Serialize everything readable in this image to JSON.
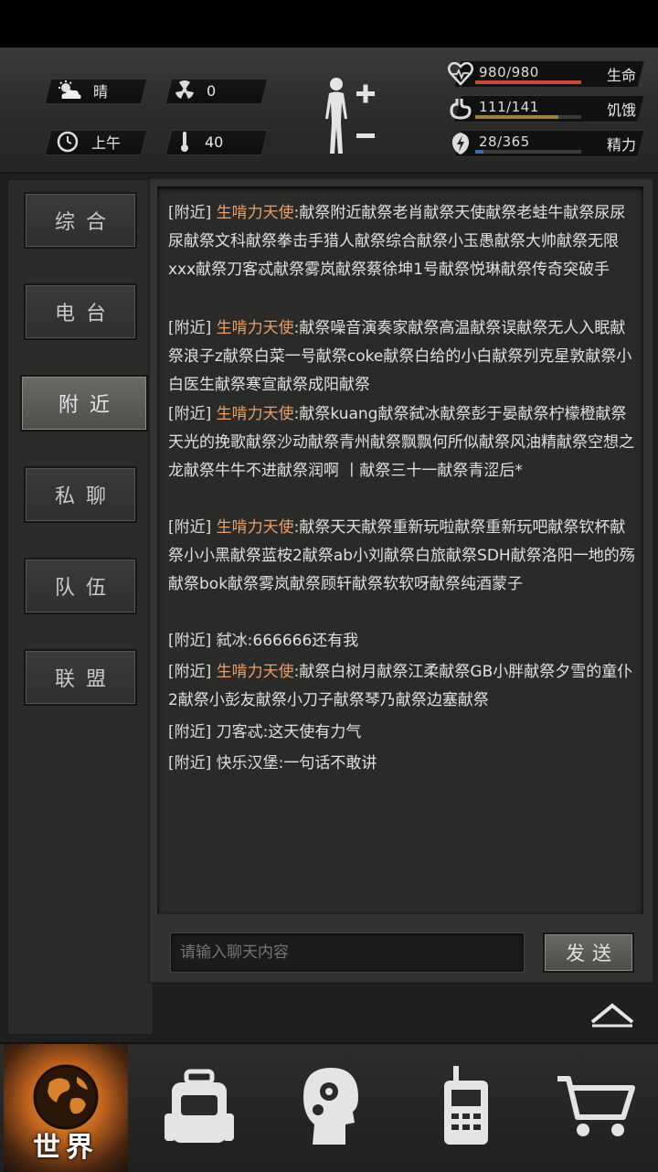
{
  "hud": {
    "weather": "晴",
    "radiation": "0",
    "time_of_day": "上午",
    "temperature": "40",
    "stats": [
      {
        "label": "生命",
        "value": "980/980",
        "fraction": 1.0,
        "color": "#c8493a",
        "icon": "heart-icon"
      },
      {
        "label": "饥饿",
        "value": "111/141",
        "fraction": 0.787,
        "color": "#a07f3d",
        "icon": "stomach-icon"
      },
      {
        "label": "精力",
        "value": "28/365",
        "fraction": 0.077,
        "color": "#3a6fb8",
        "icon": "lightning-icon"
      }
    ]
  },
  "tabs": [
    {
      "label": "综合",
      "active": false
    },
    {
      "label": "电台",
      "active": false
    },
    {
      "label": "附近",
      "active": true
    },
    {
      "label": "私聊",
      "active": false
    },
    {
      "label": "队伍",
      "active": false
    },
    {
      "label": "联盟",
      "active": false
    }
  ],
  "chat": {
    "messages": [
      {
        "channel": "[附近]",
        "sender": "生啃力天使",
        "highlight": true,
        "text": ":献祭附近献祭老肖献祭天使献祭老蛙牛献祭尿尿尿献祭文科献祭拳击手猎人献祭综合献祭小玉愚献祭大帅献祭无限xxx献祭刀客忒献祭雾岚献祭蔡徐坤1号献祭悦琳献祭传奇突破手"
      },
      {
        "channel": "[附近]",
        "sender": "生啃力天使",
        "highlight": true,
        "text": ":献祭噪音演奏家献祭高温献祭误献祭无人入眠献祭浪子z献祭白菜一号献祭coke献祭白给的小白献祭列克星敦献祭小白医生献祭寒宣献祭成阳献祭"
      },
      {
        "channel": "[附近]",
        "sender": "生啃力天使",
        "highlight": true,
        "text": ":献祭kuang献祭弑冰献祭彭于晏献祭柠檬橙献祭天光的挽歌献祭沙动献祭青州献祭飘飘何所似献祭风油精献祭空想之龙献祭牛牛不进献祭润啊 丨献祭三十一献祭青涩后*"
      },
      {
        "channel": "[附近]",
        "sender": "生啃力天使",
        "highlight": true,
        "text": ":献祭天天献祭重新玩啦献祭重新玩吧献祭钦杯献祭小小黑献祭蓝桉2献祭ab小刘献祭白旅献祭SDH献祭洛阳一地的殇献祭bok献祭雾岚献祭顾轩献祭软软呀献祭纯酒蒙子"
      },
      {
        "channel": "[附近]",
        "sender": "弑冰",
        "highlight": false,
        "text": ":666666还有我"
      },
      {
        "channel": "[附近]",
        "sender": "生啃力天使",
        "highlight": true,
        "text": ":献祭白树月献祭江柔献祭GB小胖献祭夕雪的童仆2献祭小彭友献祭小刀子献祭琴乃献祭边塞献祭"
      },
      {
        "channel": "[附近]",
        "sender": "刀客忒",
        "highlight": false,
        "text": ":这天使有力气"
      },
      {
        "channel": "[附近]",
        "sender": "快乐汉堡",
        "highlight": false,
        "text": ":一句话不敢讲"
      }
    ],
    "input_placeholder": "请输入聊天内容",
    "send_label": "发送"
  },
  "bottom_nav": {
    "world_label": "世界",
    "items": [
      "globe-icon",
      "backpack-icon",
      "head-gear-icon",
      "radio-icon",
      "cart-icon"
    ]
  }
}
